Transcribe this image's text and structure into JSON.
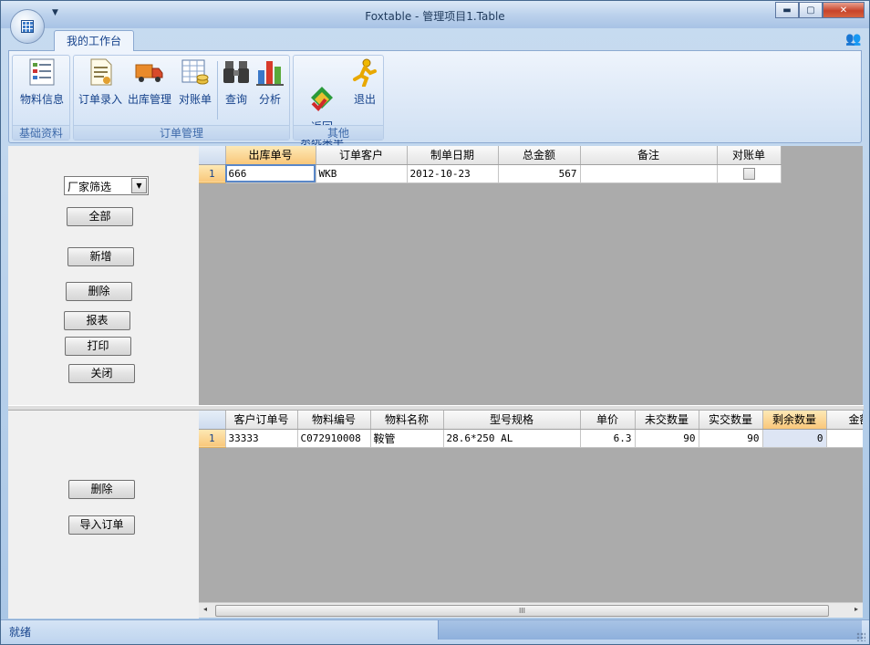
{
  "window": {
    "title": "Foxtable - 管理项目1.Table",
    "min_label": "▬",
    "max_label": "▢",
    "close_label": "✕"
  },
  "ribbon_tab": {
    "label": "我的工作台"
  },
  "ribbon": {
    "groups": [
      {
        "label": "基础资料",
        "buttons": [
          {
            "label": "物料信息"
          }
        ]
      },
      {
        "label": "订单管理",
        "buttons": [
          {
            "label": "订单录入"
          },
          {
            "label": "出库管理"
          },
          {
            "label": "对账单"
          },
          {
            "label": "查询"
          },
          {
            "label": "分析"
          }
        ]
      },
      {
        "label": "其他",
        "buttons": [
          {
            "label": "返回\n系统菜单"
          },
          {
            "label": "退出"
          }
        ]
      }
    ]
  },
  "top_panel": {
    "filter_combo": {
      "value": "厂家筛选"
    },
    "buttons": {
      "all": "全部",
      "add": "新增",
      "delete": "删除",
      "report": "报表",
      "print": "打印",
      "close": "关闭"
    }
  },
  "top_grid": {
    "columns": [
      "出库单号",
      "订单客户",
      "制单日期",
      "总金额",
      "备注",
      "对账单"
    ],
    "rows": [
      {
        "num": "1",
        "cells": [
          "666",
          "WKB",
          "2012-10-23",
          "567",
          "",
          ""
        ]
      }
    ]
  },
  "bottom_panel": {
    "buttons": {
      "delete": "删除",
      "import": "导入订单"
    }
  },
  "bottom_grid": {
    "columns": [
      "客户订单号",
      "物料编号",
      "物料名称",
      "型号规格",
      "单价",
      "未交数量",
      "实交数量",
      "剩余数量",
      "金额"
    ],
    "rows": [
      {
        "num": "1",
        "cells": [
          "33333",
          "C072910008",
          "鞍管",
          "28.6*250 AL",
          "6.3",
          "90",
          "90",
          "0",
          ""
        ]
      }
    ]
  },
  "scrollbar": {
    "grip": "III",
    "left": "◂",
    "right": "▸"
  },
  "status": {
    "text": "就绪"
  }
}
